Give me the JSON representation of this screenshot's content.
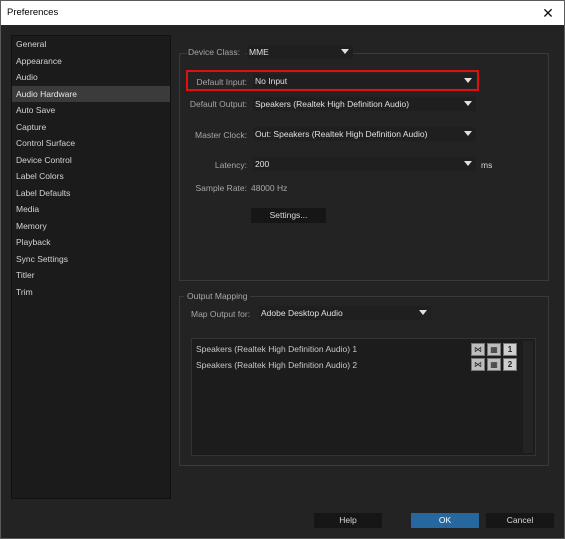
{
  "window": {
    "title": "Preferences",
    "close_glyph": "✕"
  },
  "sidebar": {
    "items": [
      {
        "label": "General",
        "active": false
      },
      {
        "label": "Appearance",
        "active": false
      },
      {
        "label": "Audio",
        "active": false
      },
      {
        "label": "Audio Hardware",
        "active": true
      },
      {
        "label": "Auto Save",
        "active": false
      },
      {
        "label": "Capture",
        "active": false
      },
      {
        "label": "Control Surface",
        "active": false
      },
      {
        "label": "Device Control",
        "active": false
      },
      {
        "label": "Label Colors",
        "active": false
      },
      {
        "label": "Label Defaults",
        "active": false
      },
      {
        "label": "Media",
        "active": false
      },
      {
        "label": "Memory",
        "active": false
      },
      {
        "label": "Playback",
        "active": false
      },
      {
        "label": "Sync Settings",
        "active": false
      },
      {
        "label": "Titler",
        "active": false
      },
      {
        "label": "Trim",
        "active": false
      }
    ]
  },
  "device": {
    "class_label": "Device Class:",
    "class_value": "MME",
    "default_input_label": "Default Input:",
    "default_input_value": "No Input",
    "default_output_label": "Default Output:",
    "default_output_value": "Speakers (Realtek High Definition Audio)",
    "master_clock_label": "Master Clock:",
    "master_clock_value": "Out: Speakers (Realtek High Definition Audio)",
    "latency_label": "Latency:",
    "latency_value": "200",
    "latency_unit": "ms",
    "sample_rate_label": "Sample Rate:",
    "sample_rate_value": "48000 Hz",
    "settings_button": "Settings..."
  },
  "output_mapping": {
    "legend": "Output Mapping",
    "map_for_label": "Map Output for:",
    "map_for_value": "Adobe Desktop Audio",
    "rows": [
      {
        "label": "Speakers (Realtek High Definition Audio) 1",
        "channel": "1"
      },
      {
        "label": "Speakers (Realtek High Definition Audio) 2",
        "channel": "2"
      }
    ]
  },
  "footer": {
    "help": "Help",
    "ok": "OK",
    "cancel": "Cancel"
  },
  "colors": {
    "highlight_box": "#e01010",
    "ok_button": "#27679f"
  }
}
